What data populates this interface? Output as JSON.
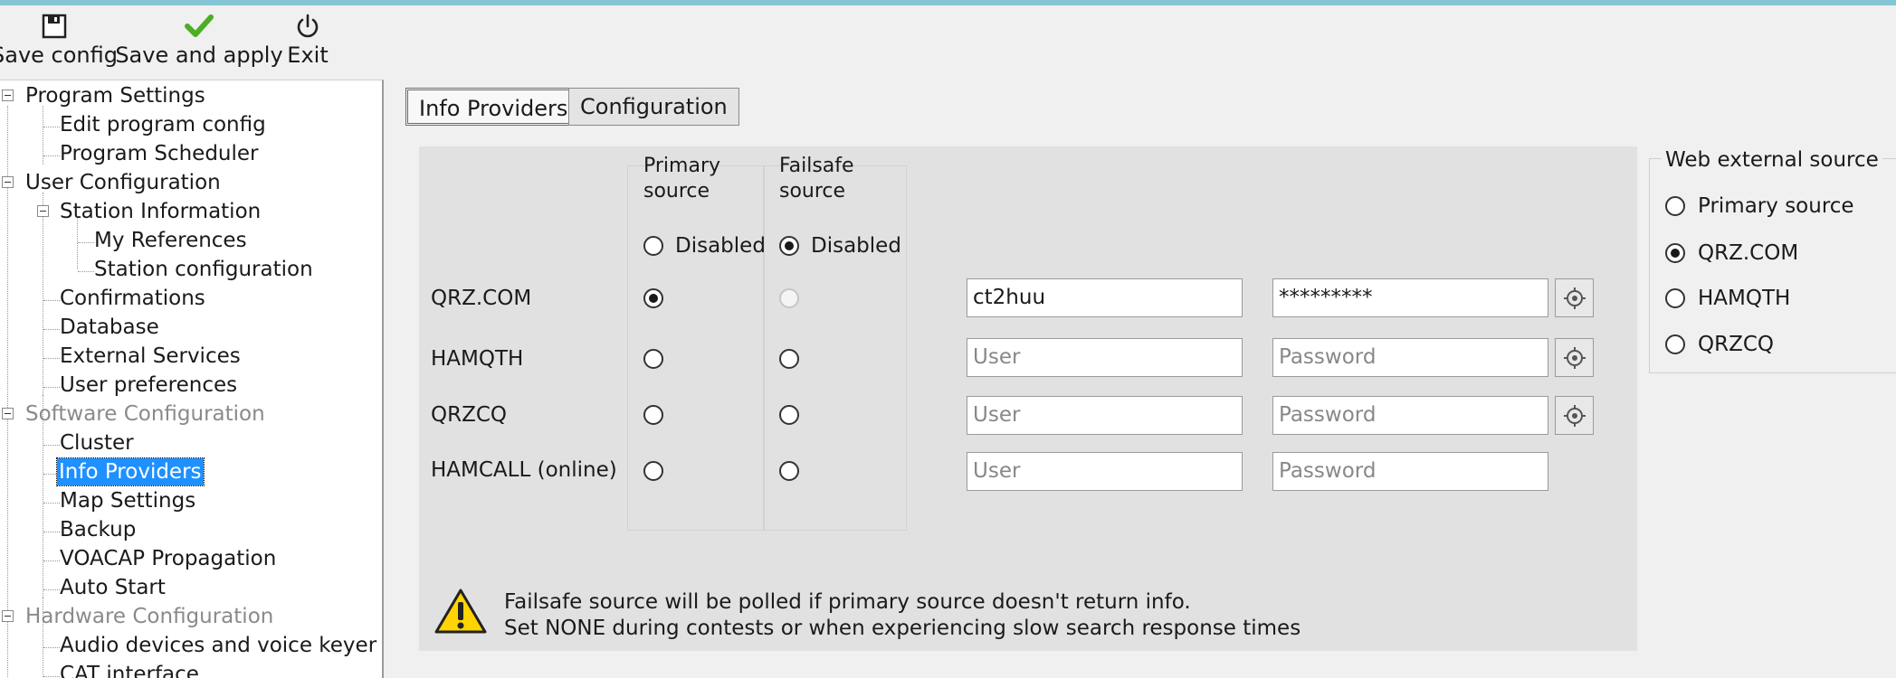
{
  "toolbar": {
    "save_config": "Save config",
    "save_apply": "Save and apply",
    "exit": "Exit"
  },
  "tree": {
    "program_settings": "Program Settings",
    "edit_program_config": "Edit program config",
    "program_scheduler": "Program Scheduler",
    "user_configuration": "User Configuration",
    "station_information": "Station Information",
    "my_references": "My References",
    "station_configuration": "Station configuration",
    "confirmations": "Confirmations",
    "database": "Database",
    "external_services": "External Services",
    "user_preferences": "User preferences",
    "software_configuration": "Software Configuration",
    "cluster": "Cluster",
    "info_providers": "Info Providers",
    "map_settings": "Map Settings",
    "backup": "Backup",
    "voacap": "VOACAP Propagation",
    "auto_start": "Auto Start",
    "hardware_configuration": "Hardware Configuration",
    "audio_devices": "Audio devices and voice keyer",
    "cat_interface": "CAT interface"
  },
  "tabs": {
    "info_providers": "Info Providers",
    "configuration": "Configuration"
  },
  "columns": {
    "primary_line1": "Primary",
    "primary_line2": "source",
    "failsafe_line1": "Failsafe",
    "failsafe_line2": "source",
    "disabled": "Disabled"
  },
  "providers": [
    {
      "name": "QRZ.COM",
      "user": "ct2huu",
      "password": "*********"
    },
    {
      "name": "HAMQTH",
      "user_placeholder": "User",
      "password_placeholder": "Password"
    },
    {
      "name": "QRZCQ",
      "user_placeholder": "User",
      "password_placeholder": "Password"
    },
    {
      "name": "HAMCALL (online)",
      "user_placeholder": "User",
      "password_placeholder": "Password"
    }
  ],
  "warning": {
    "line1": "Failsafe source will be polled if primary source doesn't return info.",
    "line2": "Set NONE during contests or when experiencing slow search response times"
  },
  "web_external": {
    "title": "Web external source",
    "options": [
      "Primary source",
      "QRZ.COM",
      "HAMQTH",
      "QRZCQ"
    ],
    "selected": "QRZ.COM"
  },
  "colors": {
    "selection": "#1e90ff",
    "top_accent": "#84c6d6",
    "save_apply_check": "#4cae22"
  }
}
